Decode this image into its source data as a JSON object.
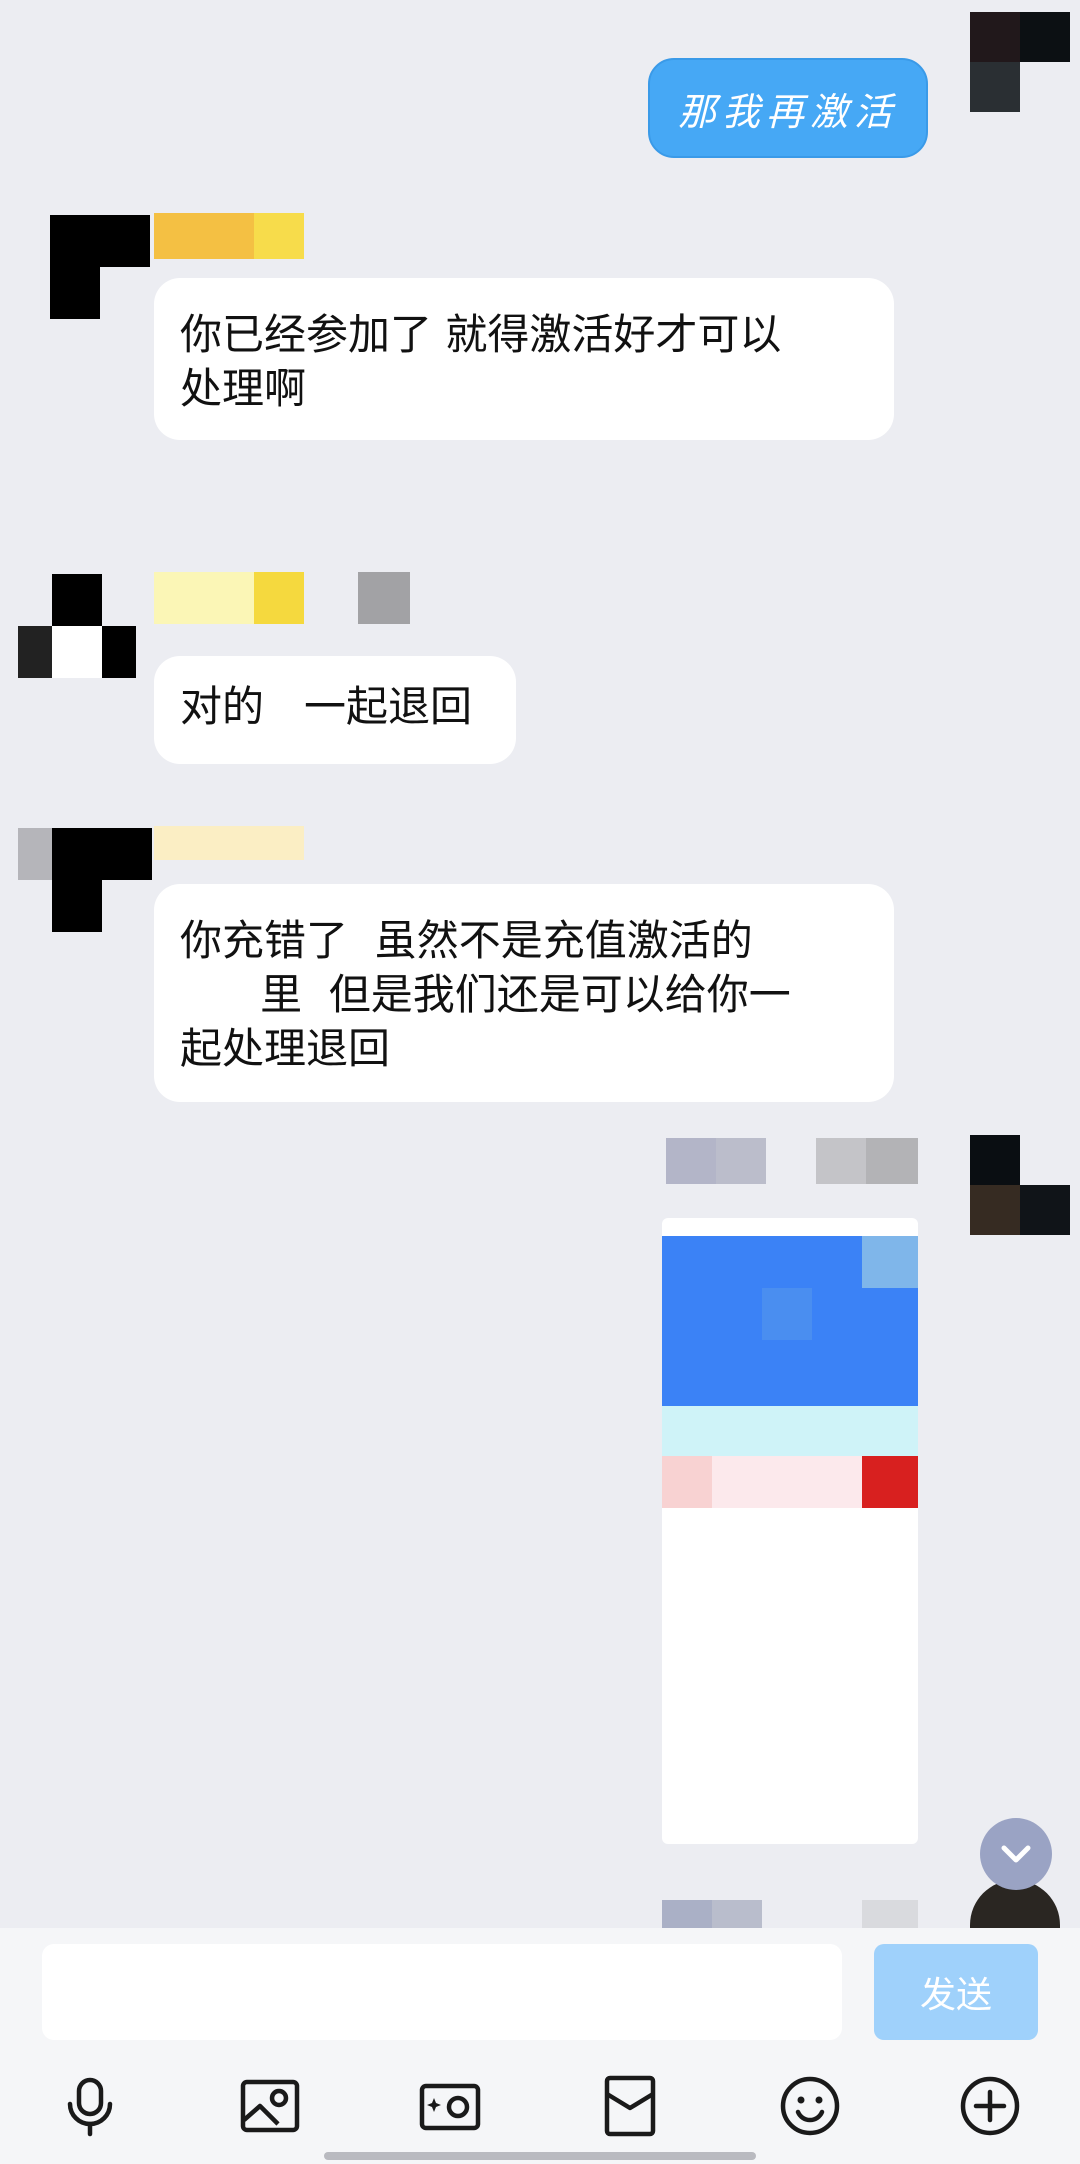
{
  "messages": [
    {
      "side": "right",
      "text": "那我再激活"
    },
    {
      "side": "left",
      "lines": [
        "你已经参加了  就得激活好才可以",
        "处理啊"
      ]
    },
    {
      "side": "left",
      "lines": [
        "对的   一起退回"
      ]
    },
    {
      "side": "left",
      "lines": [
        "你充错了  虽然不是充值激活的",
        "      里  但是我们还是可以给你一",
        "起处理退回"
      ]
    }
  ],
  "input": {
    "value": "",
    "placeholder": ""
  },
  "send_label": "发送",
  "toolbar": [
    "mic-icon",
    "image-icon",
    "camera-icon",
    "red-packet-icon",
    "emoji-icon",
    "plus-icon"
  ],
  "colors": {
    "background": "#ecedf2",
    "outgoing_bubble": "#46a8f5",
    "send_button": "#9fd1fb"
  }
}
